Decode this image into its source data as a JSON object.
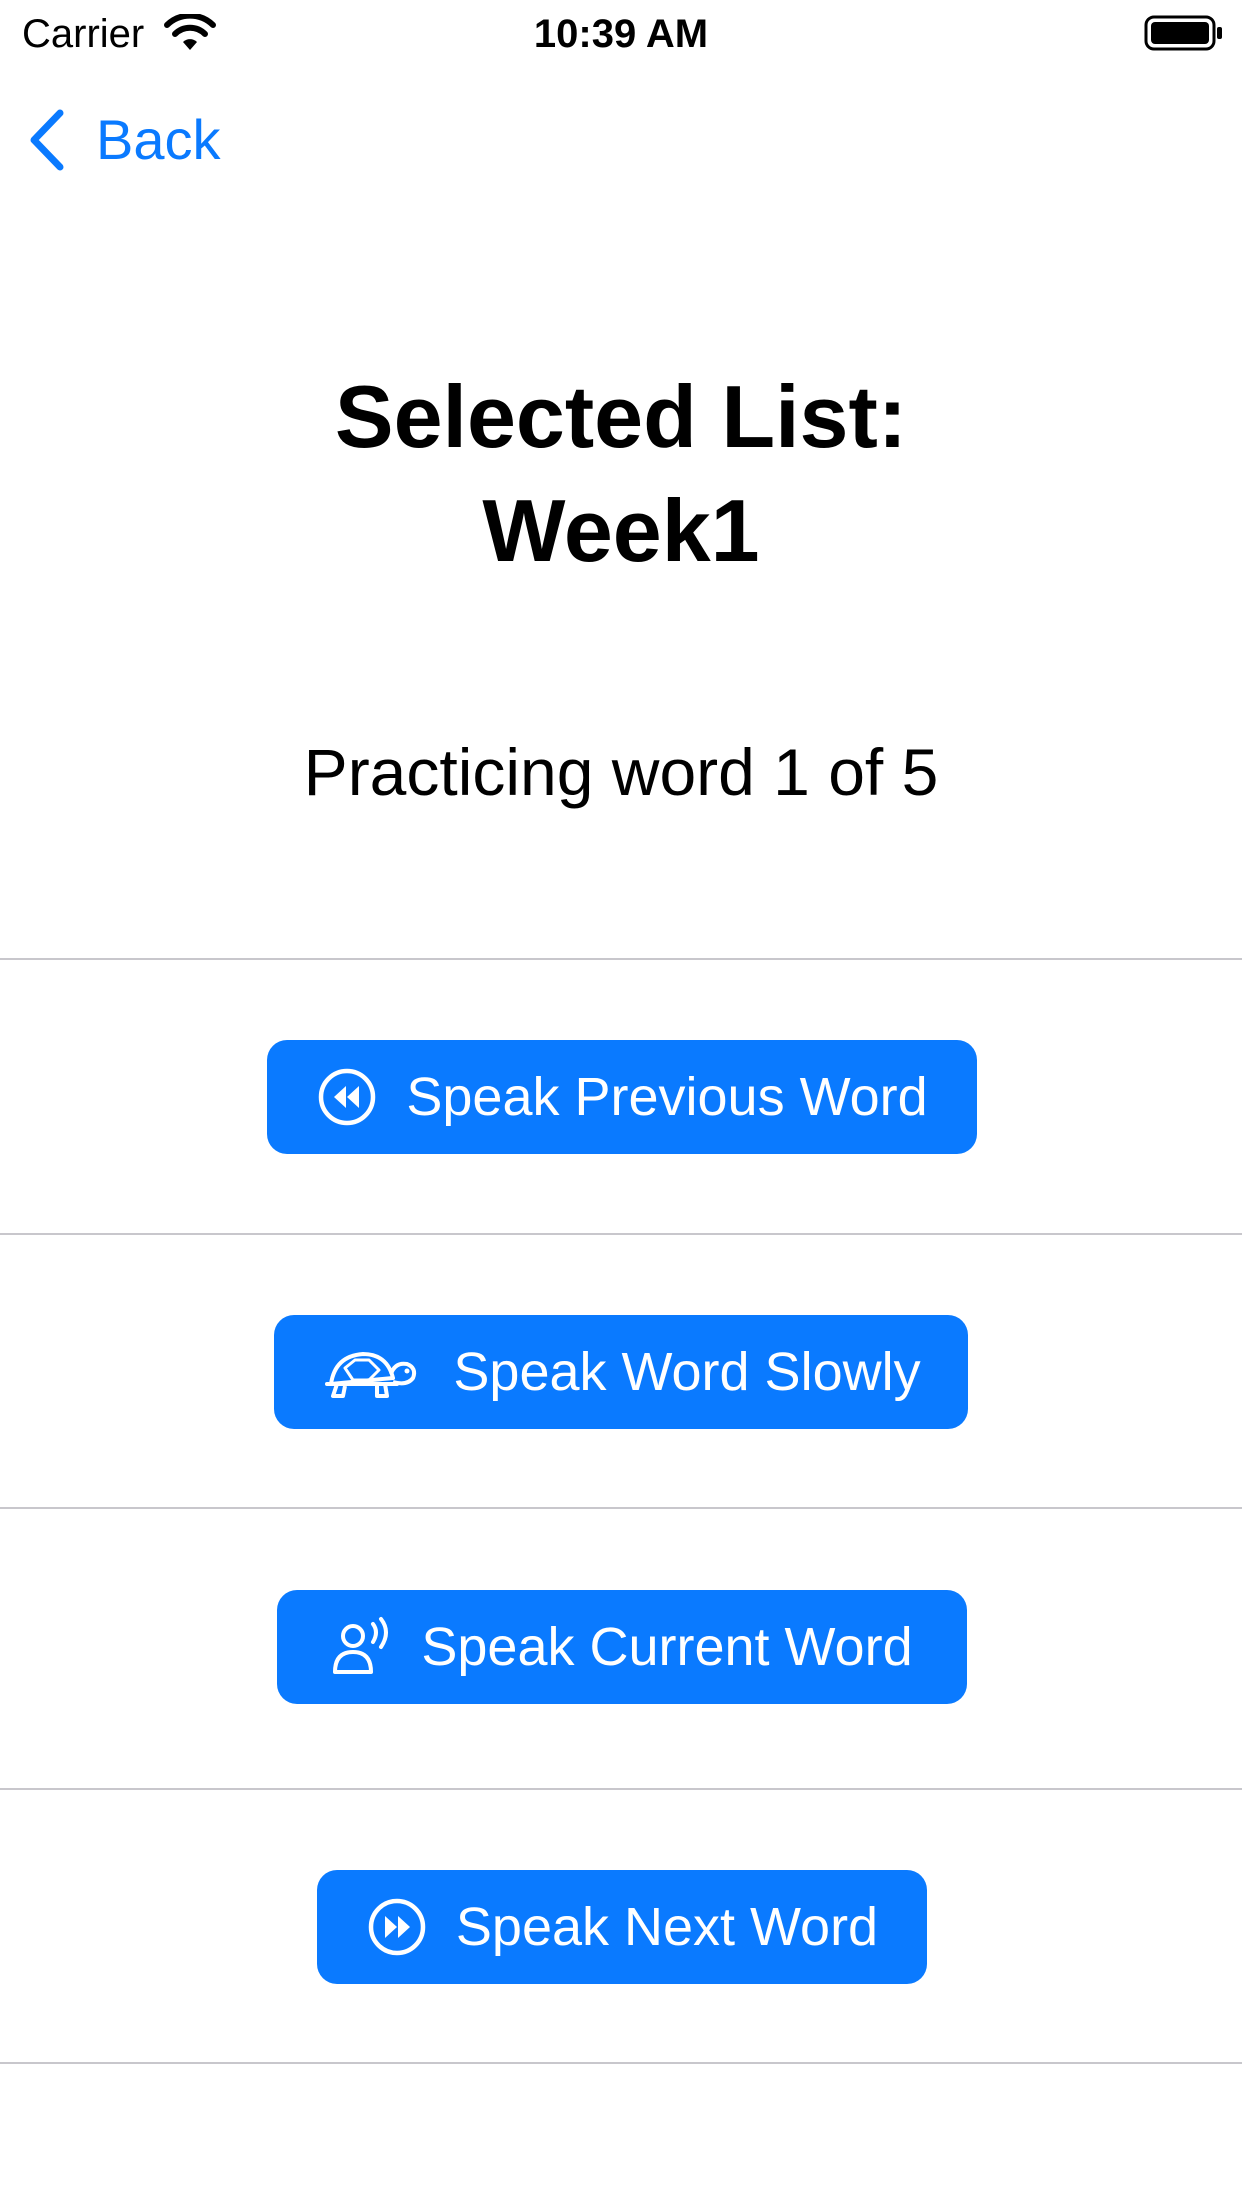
{
  "status_bar": {
    "carrier": "Carrier",
    "time": "10:39 AM",
    "wifi_icon": "wifi-icon",
    "battery_icon": "battery-icon"
  },
  "nav": {
    "back_label": "Back",
    "back_icon": "chevron-left-icon"
  },
  "header": {
    "title_line1": "Selected List:",
    "title_line2": "Week1"
  },
  "progress": {
    "text": "Practicing word 1 of 5"
  },
  "actions": [
    {
      "label": "Speak Previous Word",
      "icon": "backward-circle-icon"
    },
    {
      "label": "Speak Word Slowly",
      "icon": "tortoise-icon"
    },
    {
      "label": "Speak Current Word",
      "icon": "person-speaking-icon"
    },
    {
      "label": "Speak Next Word",
      "icon": "forward-circle-icon"
    }
  ],
  "colors": {
    "accent": "#0a7aff",
    "divider": "#c8c7cc",
    "background": "#ffffff"
  }
}
